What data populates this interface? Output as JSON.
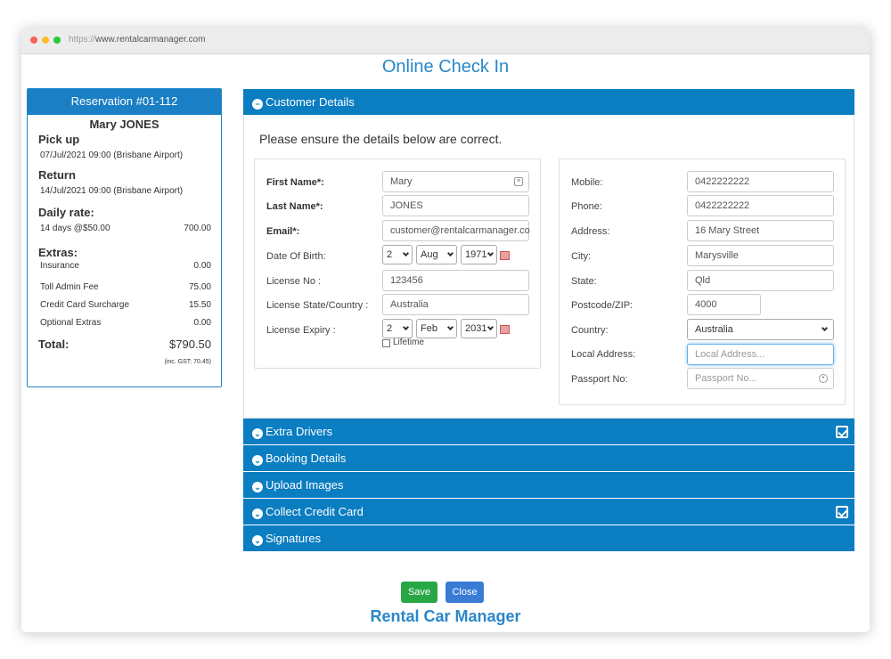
{
  "browser": {
    "url_protocol": "https://",
    "url_host": "www.rentalcarmanager.com"
  },
  "page_title": "Online Check In",
  "summary": {
    "header": "Reservation #01-112",
    "customer_name": "Mary JONES",
    "pickup_label": "Pick up",
    "pickup_value": "07/Jul/2021 09:00 (Brisbane Airport)",
    "return_label": "Return",
    "return_value": "14/Jul/2021 09:00 (Brisbane Airport)",
    "daily_rate_label": "Daily rate:",
    "daily_rate_desc": "14 days @$50.00",
    "daily_rate_amount": "700.00",
    "extras_label": "Extras:",
    "extras": [
      {
        "name": "Insurance",
        "amount": "0.00"
      },
      {
        "name": "Toll Admin Fee",
        "amount": "75.00"
      },
      {
        "name": "Credit Card Surcharge",
        "amount": "15.50"
      },
      {
        "name": "Optional Extras",
        "amount": "0.00"
      }
    ],
    "total_label": "Total:",
    "total_amount": "$790.50",
    "gst_note": "(inc. GST: 70.45)"
  },
  "sections": [
    {
      "label": "Customer Details",
      "expanded": true,
      "completed": false
    },
    {
      "label": "Extra Drivers",
      "expanded": false,
      "completed": true
    },
    {
      "label": "Booking Details",
      "expanded": false,
      "completed": false
    },
    {
      "label": "Upload Images",
      "expanded": false,
      "completed": false
    },
    {
      "label": "Collect Credit Card",
      "expanded": false,
      "completed": true
    },
    {
      "label": "Signatures",
      "expanded": false,
      "completed": false
    }
  ],
  "customer": {
    "intro": "Please ensure the details below are correct.",
    "first_name_label": "First Name*:",
    "first_name": "Mary",
    "last_name_label": "Last Name*:",
    "last_name": "JONES",
    "email_label": "Email*:",
    "email": "customer@rentalcarmanager.co",
    "dob_label": "Date Of Birth:",
    "dob_day": "2",
    "dob_month": "Aug",
    "dob_year": "1971",
    "license_no_label": "License No :",
    "license_no": "123456",
    "license_state_label": "License State/Country :",
    "license_state": "Australia",
    "license_expiry_label": "License Expiry :",
    "expiry_day": "2",
    "expiry_month": "Feb",
    "expiry_year": "2031",
    "lifetime_label": "Lifetime",
    "mobile_label": "Mobile:",
    "mobile": "0422222222",
    "phone_label": "Phone:",
    "phone": "0422222222",
    "address_label": "Address:",
    "address": "16 Mary Street",
    "city_label": "City:",
    "city": "Marysville",
    "state_label": "State:",
    "state": "Qld",
    "postcode_label": "Postcode/ZIP:",
    "postcode": "4000",
    "country_label": "Country:",
    "country": "Australia",
    "local_address_label": "Local Address:",
    "local_address_placeholder": "Local Address...",
    "passport_label": "Passport No:",
    "passport_placeholder": "Passport No..."
  },
  "buttons": {
    "save": "Save",
    "close": "Close",
    "save_color": "#28a745",
    "close_color": "#3a7bd5"
  },
  "footer_brand": "Rental Car Manager",
  "colors": {
    "accent": "#0b7dc1",
    "title": "#2a87c8"
  }
}
